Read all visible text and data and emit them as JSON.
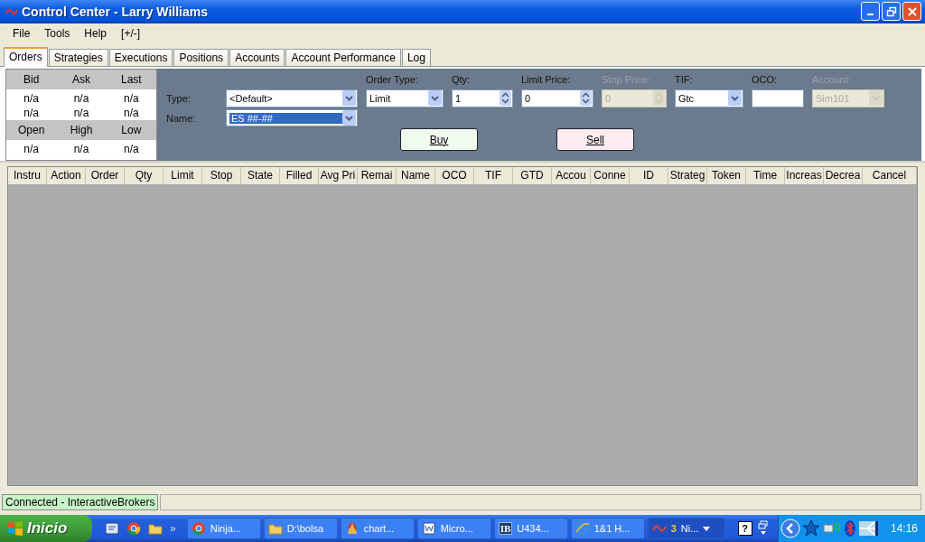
{
  "window": {
    "title": "Control Center - Larry Williams"
  },
  "menu": [
    "File",
    "Tools",
    "Help",
    "[+/-]"
  ],
  "tabs": [
    {
      "label": "Orders",
      "selected": true
    },
    {
      "label": "Strategies",
      "selected": false
    },
    {
      "label": "Executions",
      "selected": false
    },
    {
      "label": "Positions",
      "selected": false
    },
    {
      "label": "Accounts",
      "selected": false
    },
    {
      "label": "Account Performance",
      "selected": false
    },
    {
      "label": "Log",
      "selected": false
    }
  ],
  "quote": {
    "headers": [
      "Bid",
      "Ask",
      "Last"
    ],
    "rows": [
      [
        "n/a",
        "n/a",
        "n/a"
      ],
      [
        "n/a",
        "n/a",
        "n/a"
      ]
    ],
    "headers2": [
      "Open",
      "High",
      "Low"
    ],
    "rows2": [
      [
        "n/a",
        "n/a",
        "n/a"
      ]
    ]
  },
  "order_form": {
    "type": {
      "label": "Type:",
      "value": "<Default>"
    },
    "name": {
      "label": "Name:",
      "value": "ES ##-##",
      "selected": true
    },
    "fields": [
      {
        "kind": "combo",
        "label": "Order Type:",
        "value": "Limit",
        "disabled": false
      },
      {
        "kind": "spin",
        "label": "Qty:",
        "value": "1",
        "disabled": false
      },
      {
        "kind": "spin",
        "label": "Limit Price:",
        "value": "0",
        "disabled": false
      },
      {
        "kind": "spin",
        "label": "Stop Price:",
        "value": "0",
        "disabled": true
      },
      {
        "kind": "combo",
        "label": "TIF:",
        "value": "Gtc",
        "disabled": false
      },
      {
        "kind": "text",
        "label": "OCO:",
        "disabled": false
      },
      {
        "kind": "combo",
        "label": "Account:",
        "value": "Sim101",
        "disabled": true
      }
    ],
    "buy": "Buy",
    "sell": "Sell"
  },
  "table": {
    "columns": [
      "Instru",
      "Action",
      "Order",
      "Qty",
      "Limit",
      "Stop",
      "State",
      "Filled",
      "Avg Pri",
      "Remai",
      "Name",
      "OCO",
      "TIF",
      "GTD",
      "Accou",
      "Conne",
      "ID",
      "Strateg",
      "Token",
      "Time",
      "Increas",
      "Decrea",
      "Cancel"
    ]
  },
  "status_bar": {
    "text": "Connected - InteractiveBrokers"
  },
  "taskbar": {
    "start": "Inicio",
    "more": "»",
    "tasks": [
      {
        "label": "Ninja...",
        "selected": false
      },
      {
        "label": "D:\\bolsa",
        "selected": false
      },
      {
        "label": "chart...",
        "selected": false
      },
      {
        "label": "Micro...",
        "selected": false
      },
      {
        "badge": "IB",
        "label": "U434...",
        "selected": false
      },
      {
        "label": "1&1 H...",
        "selected": false
      },
      {
        "count": "3",
        "label": "Ni...",
        "selected": true
      }
    ],
    "help": "?",
    "clock": "14:16"
  }
}
